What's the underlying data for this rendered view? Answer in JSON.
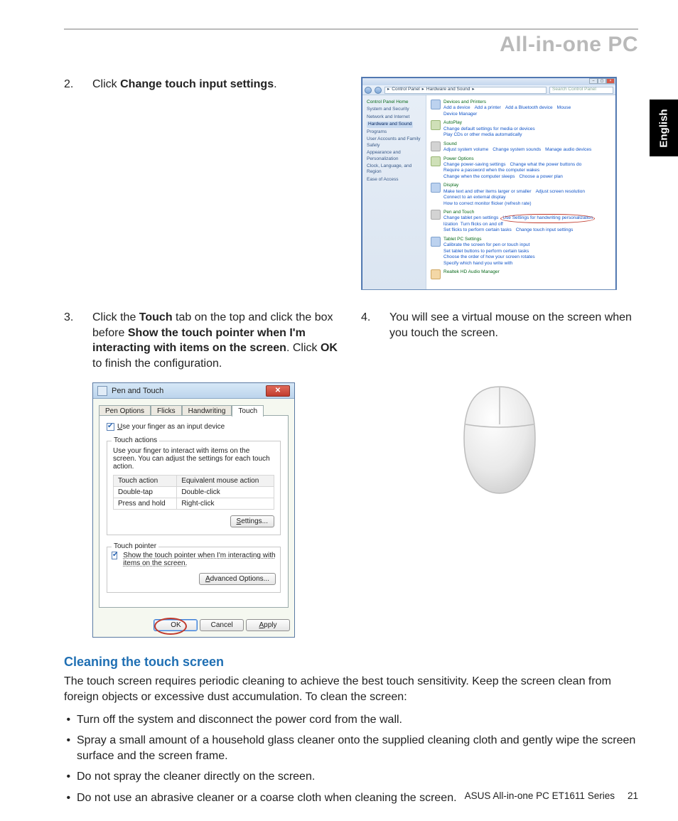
{
  "header": {
    "title": "All-in-one PC"
  },
  "lang_tab": "English",
  "step2": {
    "num": "2.",
    "t1": "Click ",
    "b1": "Change touch input settings",
    "t2": "."
  },
  "step3": {
    "num": "3.",
    "t1": "Click the ",
    "b1": "Touch",
    "t2": " tab on the top and click the box before ",
    "b2": "Show the touch pointer when I'm interacting with items on the screen",
    "t3": ". Click ",
    "b3": "OK",
    "t4": " to finish the configuration."
  },
  "step4": {
    "num": "4.",
    "t1": "You will see a virtual mouse on the screen when you touch the screen."
  },
  "cp": {
    "crumb1": "Control Panel",
    "crumb2": "Hardware and Sound",
    "search_placeholder": "Search Control Panel",
    "side_home": "Control Panel Home",
    "side_items": [
      "System and Security",
      "Network and Internet",
      "Hardware and Sound",
      "Programs",
      "User Accounts and Family Safety",
      "Appearance and Personalization",
      "Clock, Language, and Region",
      "Ease of Access"
    ],
    "groups": {
      "dev": {
        "t": "Devices and Printers",
        "l": [
          "Add a device",
          "Add a printer",
          "Add a Bluetooth device",
          "Mouse",
          "Device Manager"
        ]
      },
      "auto": {
        "t": "AutoPlay",
        "l": [
          "Change default settings for media or devices",
          "Play CDs or other media automatically"
        ]
      },
      "sound": {
        "t": "Sound",
        "l": [
          "Adjust system volume",
          "Change system sounds",
          "Manage audio devices"
        ]
      },
      "power": {
        "t": "Power Options",
        "l": [
          "Change power-saving settings",
          "Change what the power buttons do",
          "Require a password when the computer wakes",
          "Change when the computer sleeps",
          "Choose a power plan"
        ]
      },
      "display": {
        "t": "Display",
        "l": [
          "Make text and other items larger or smaller",
          "Adjust screen resolution",
          "Connect to an external display",
          "How to correct monitor flicker (refresh rate)"
        ]
      },
      "pen": {
        "t": "Pen and Touch",
        "l": [
          "Change tablet pen settings",
          "Use Settings for handwriting personalization",
          "Turn flicks on and off",
          "Set flicks to perform certain tasks",
          "Change touch input settings"
        ]
      },
      "tablet": {
        "t": "Tablet PC Settings",
        "l": [
          "Calibrate the screen for pen or touch input",
          "Set tablet buttons to perform certain tasks",
          "Choose the order of how your screen rotates",
          "Specify which hand you write with"
        ]
      },
      "realtek": {
        "t": "Realtek HD Audio Manager"
      }
    }
  },
  "pt": {
    "title": "Pen and Touch",
    "tabs": [
      "Pen Options",
      "Flicks",
      "Handwriting",
      "Touch"
    ],
    "use_finger_pre": "U",
    "use_finger_rest": "se your finger as an input device",
    "actions_label": "Touch actions",
    "actions_text": "Use your finger to interact with items on the screen. You can adjust the settings for each touch action.",
    "col1": "Touch action",
    "col2": "Equivalent mouse action",
    "r1c1": "Double-tap",
    "r1c2": "Double-click",
    "r2c1": "Press and hold",
    "r2c2": "Right-click",
    "settings_pre": "S",
    "settings_rest": "ettings...",
    "pointer_label": "Touch pointer",
    "pointer_text": "Show the touch pointer when I'm interacting with items on the screen.",
    "adv_pre": "A",
    "adv_rest": "dvanced Options...",
    "ok": "OK",
    "cancel": "Cancel",
    "apply_pre": "A",
    "apply_rest": "pply"
  },
  "section_title": "Cleaning the touch screen",
  "para": "The touch screen requires periodic cleaning to achieve the best touch sensitivity. Keep the screen clean from foreign objects or excessive dust accumulation. To clean the screen:",
  "bullets": [
    "Turn off the system and disconnect the power cord from the wall.",
    "Spray a small amount of a household glass cleaner onto the supplied cleaning cloth and gently wipe the screen surface and the screen frame.",
    "Do not spray the cleaner directly on the screen.",
    "Do not use an abrasive cleaner or a coarse cloth when cleaning the screen."
  ],
  "footer": {
    "text": "ASUS All-in-one PC  ET1611 Series",
    "page": "21"
  }
}
